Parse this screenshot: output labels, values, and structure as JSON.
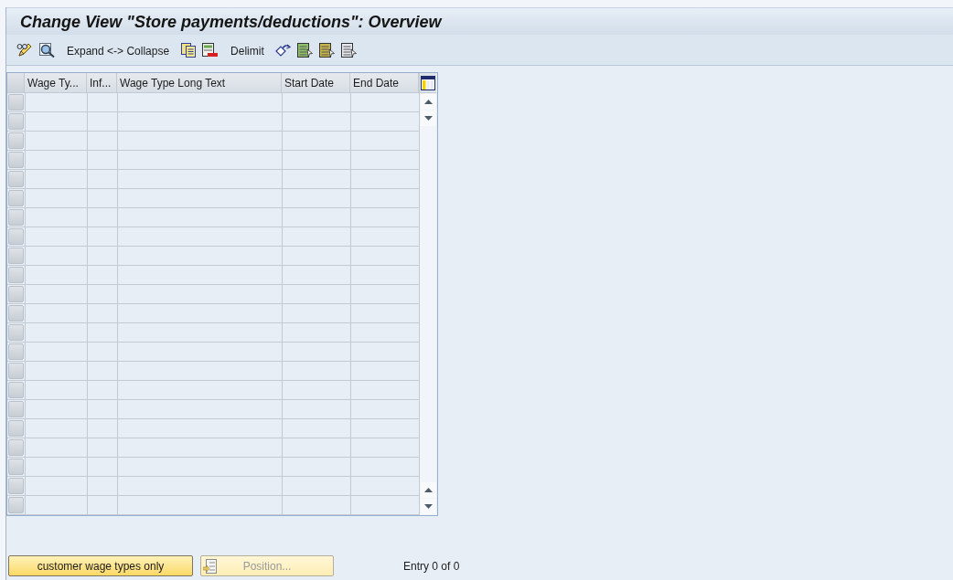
{
  "window": {
    "title": "Change View \"Store payments/deductions\": Overview"
  },
  "toolbar": {
    "buttons": [
      {
        "label": "Expand <-> Collapse"
      },
      {
        "label": "Delimit"
      }
    ]
  },
  "table": {
    "columns": [
      "Wage Ty...",
      "Inf...",
      "Wage Type Long Text",
      "Start Date",
      "End Date"
    ],
    "rows": [
      {
        "selected": false
      },
      {
        "selected": false
      },
      {
        "selected": false
      },
      {
        "selected": false
      },
      {
        "selected": false
      },
      {
        "selected": false
      },
      {
        "selected": false
      },
      {
        "selected": false
      },
      {
        "selected": false
      },
      {
        "selected": false
      },
      {
        "selected": false
      },
      {
        "selected": false
      },
      {
        "selected": false
      },
      {
        "selected": false
      },
      {
        "selected": false
      },
      {
        "selected": false
      },
      {
        "selected": false
      },
      {
        "selected": false
      },
      {
        "selected": false
      },
      {
        "selected": false
      },
      {
        "selected": false
      },
      {
        "selected": false
      }
    ]
  },
  "footer": {
    "buttons": [
      {
        "label": "customer wage types only",
        "disabled": false
      },
      {
        "label": "Position...",
        "disabled": true
      }
    ],
    "status": "Entry 0 of 0"
  }
}
